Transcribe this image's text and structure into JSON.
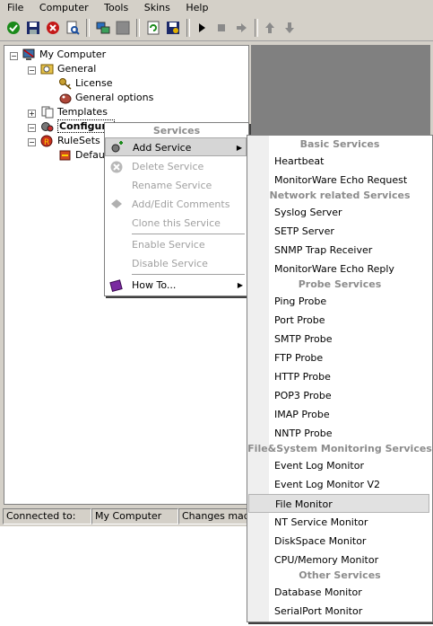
{
  "menubar": [
    "File",
    "Computer",
    "Tools",
    "Skins",
    "Help"
  ],
  "toolbar_icons": [
    "check-icon",
    "save-icon",
    "delete-icon",
    "search-icon",
    "network-icon",
    "blank-icon",
    "refresh-icon",
    "save-as-icon",
    "play-icon",
    "stop-icon",
    "step-icon",
    "up-arrow-icon",
    "down-arrow-icon"
  ],
  "tree": {
    "my_computer": "My Computer",
    "general": "General",
    "license": "License",
    "general_options": "General options",
    "templates": "Templates",
    "configured": "Configure",
    "rulesets": "RuleSets",
    "default": "Defau"
  },
  "context_menu": {
    "header": "Services",
    "add_service": "Add Service",
    "delete_service": "Delete Service",
    "rename_service": "Rename Service",
    "add_edit_comments": "Add/Edit Comments",
    "clone_service": "Clone this Service",
    "enable_service": "Enable Service",
    "disable_service": "Disable Service",
    "how_to": "How To..."
  },
  "submenu": {
    "basic_header": "Basic Services",
    "basic": [
      "Heartbeat",
      "MonitorWare Echo Request"
    ],
    "network_header": "Network related Services",
    "network": [
      "Syslog Server",
      "SETP Server",
      "SNMP Trap Receiver",
      "MonitorWare Echo Reply"
    ],
    "probe_header": "Probe Services",
    "probe": [
      "Ping Probe",
      "Port Probe",
      "SMTP Probe",
      "FTP Probe",
      "HTTP Probe",
      "POP3 Probe",
      "IMAP Probe",
      "NNTP Probe"
    ],
    "filesystem_header": "File&System Monitoring Services",
    "filesystem": [
      "Event Log Monitor",
      "Event Log Monitor V2",
      "File Monitor",
      "NT Service Monitor",
      "DiskSpace Monitor",
      "CPU/Memory Monitor"
    ],
    "other_header": "Other Services",
    "other": [
      "Database Monitor",
      "SerialPort Monitor"
    ],
    "selected": "File Monitor"
  },
  "status": {
    "connected_label": "Connected to:",
    "computer": "My Computer",
    "changes": "Changes made"
  }
}
